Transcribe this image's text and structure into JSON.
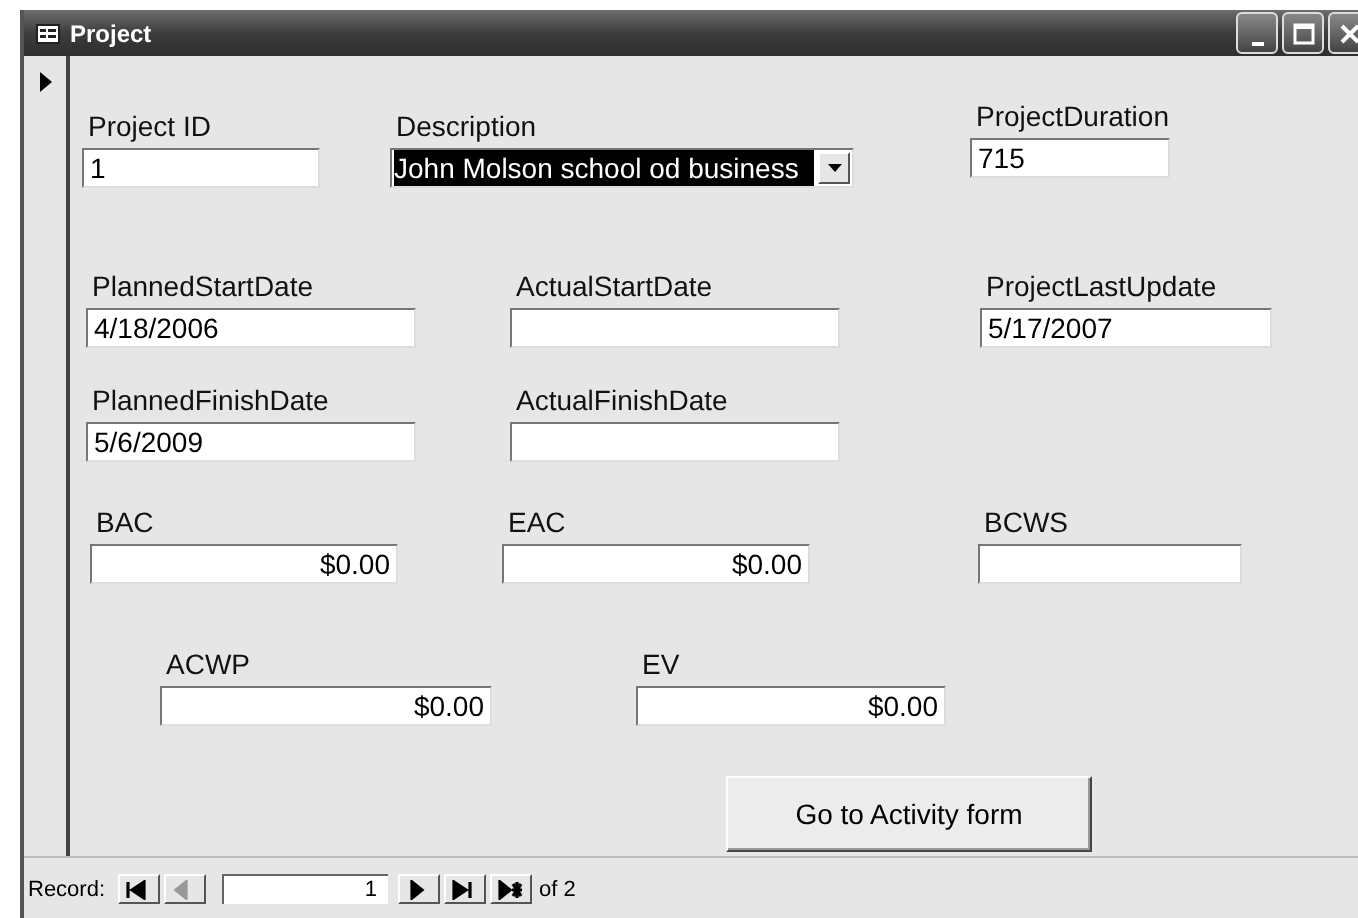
{
  "window": {
    "title": "Project"
  },
  "record_selector": {
    "current": true
  },
  "fields": [
    {
      "label": "Project ID",
      "value": "1",
      "kind": "text"
    },
    {
      "label": "Description",
      "value": "John Molson school od business",
      "kind": "combo",
      "selected": true
    },
    {
      "label": "ProjectDuration",
      "value": "715",
      "kind": "text"
    },
    {
      "label": "PlannedStartDate",
      "value": "4/18/2006",
      "kind": "text"
    },
    {
      "label": "ActualStartDate",
      "kind": "text"
    },
    {
      "label": "ProjectLastUpdate",
      "value": "5/17/2007",
      "kind": "text"
    },
    {
      "label": "PlannedFinishDate",
      "value": "5/6/2009",
      "kind": "text"
    },
    {
      "label": "ActualFinishDate",
      "kind": "text"
    },
    {
      "label": "BAC",
      "value": "$0.00",
      "kind": "currency"
    },
    {
      "label": "EAC",
      "value": "$0.00",
      "kind": "currency"
    },
    {
      "label": "BCWS",
      "kind": "currency"
    },
    {
      "label": "ACWP",
      "value": "$0.00",
      "kind": "currency"
    },
    {
      "label": "EV",
      "value": "$0.00",
      "kind": "currency"
    }
  ],
  "button": "Go to Activity form",
  "navigation": {
    "label": "Record:",
    "current": "1",
    "total": "of 2",
    "buttons": [
      {
        "kind": "first",
        "disabled": false
      },
      {
        "kind": "prev",
        "disabled": true
      },
      {
        "kind": "next",
        "disabled": false
      },
      {
        "kind": "last",
        "disabled": false
      },
      {
        "kind": "new",
        "disabled": false
      }
    ]
  }
}
